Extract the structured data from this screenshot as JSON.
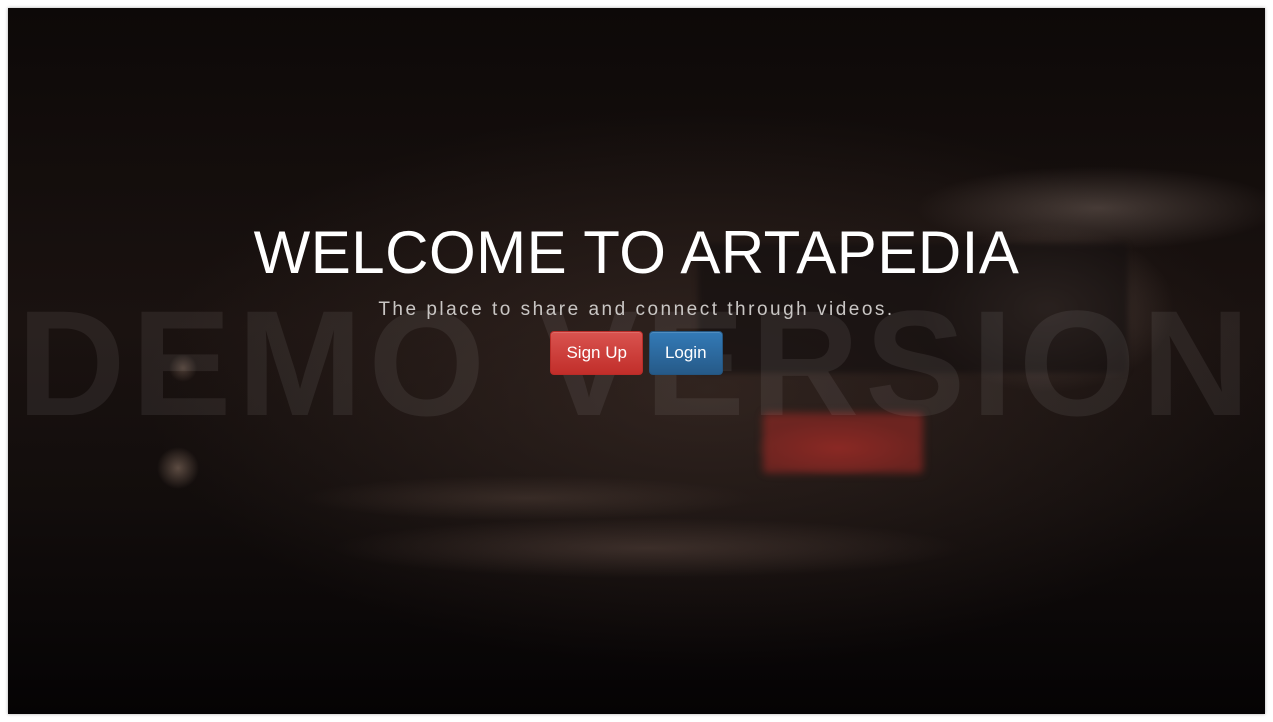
{
  "hero": {
    "title": "WELCOME TO ARTAPEDIA",
    "subtitle": "The place to share and connect through videos."
  },
  "watermark": "DEMO VERSION",
  "buttons": {
    "signup_label": "Sign Up",
    "login_label": "Login"
  },
  "colors": {
    "signup": "#d9534f",
    "login": "#337ab7"
  }
}
